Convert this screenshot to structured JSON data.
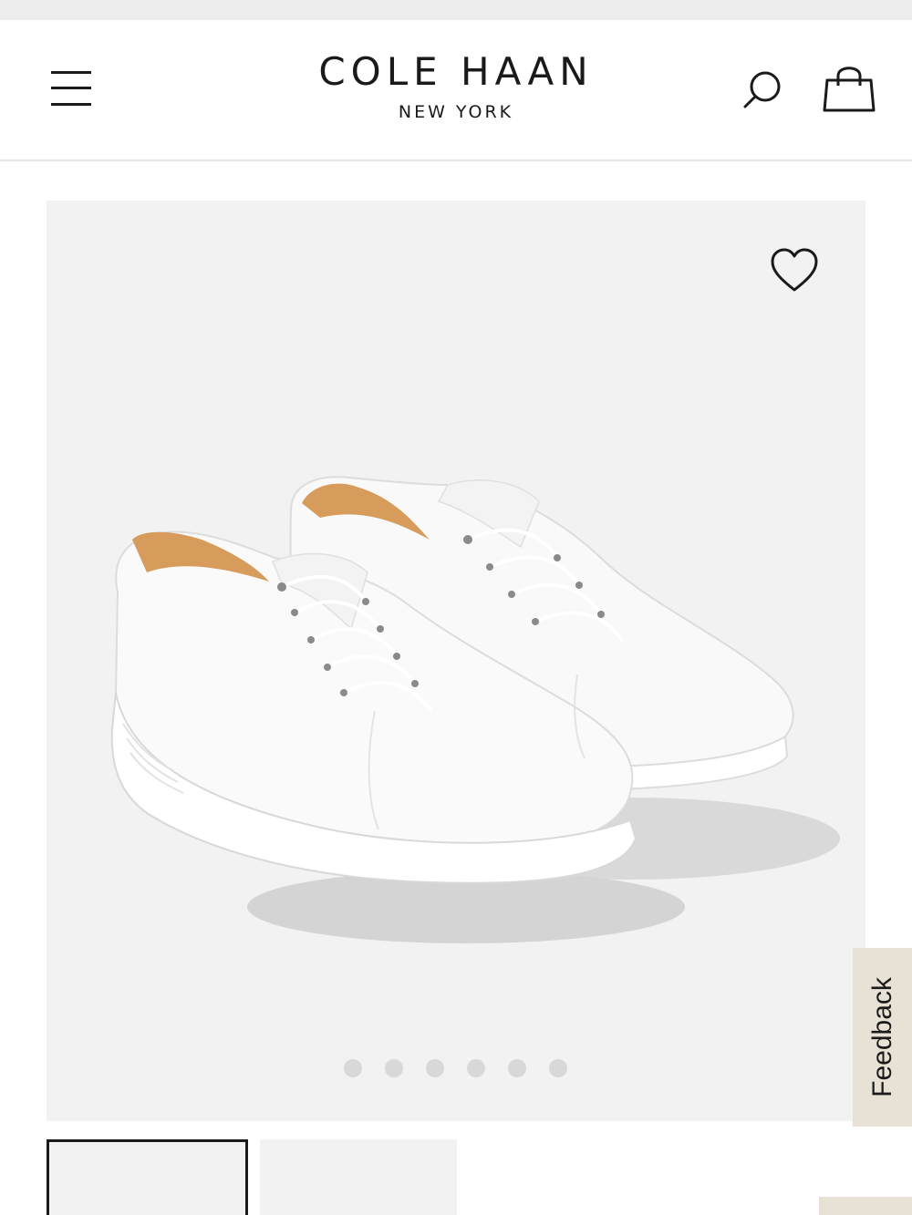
{
  "header": {
    "logo_main": "COLE HAAN",
    "logo_sub": "NEW YORK",
    "menu_icon": "hamburger-menu-icon",
    "search_icon": "search-icon",
    "bag_icon": "shopping-bag-icon"
  },
  "product": {
    "image": "white-leather-sneakers-image",
    "wishlist_icon": "heart-icon",
    "carousel": {
      "slide_count": 6,
      "active_index": 0
    },
    "thumbnails_visible": 2,
    "selected_thumbnail": 0
  },
  "feedback": {
    "label": "Feedback"
  },
  "colors": {
    "image_background": "#f2f2f2",
    "feedback_tab": "#e7e2d5",
    "text": "#1a1a1a",
    "dot": "#d8d8d8"
  }
}
